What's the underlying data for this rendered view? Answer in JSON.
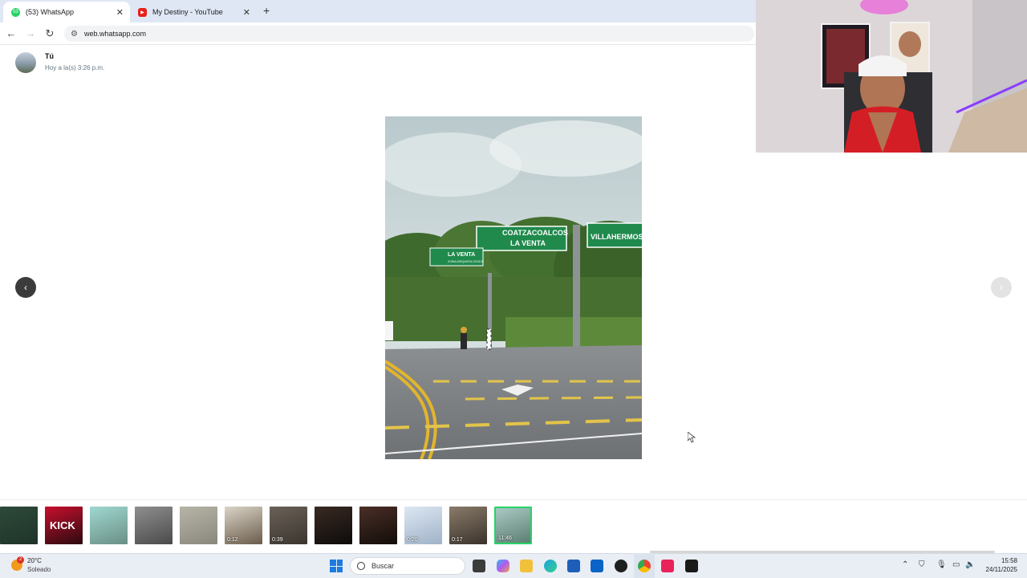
{
  "browser": {
    "tabs": [
      {
        "title": "(53) WhatsApp",
        "icon": "whatsapp-icon",
        "active": true
      },
      {
        "title": "My Destiny - YouTube",
        "icon": "youtube-icon",
        "active": false
      }
    ],
    "url": "web.whatsapp.com"
  },
  "viewer": {
    "sender": "Tú",
    "timestamp": "Hoy a la(s) 3:26 p.m.",
    "photo_signs": {
      "main_line1": "COATZACOALCOS",
      "main_line2": "LA VENTA",
      "right": "VILLAHERMOSA C",
      "left_line1": "LA VENTA",
      "left_line2": "ZONA ARQUEOLOGICA"
    }
  },
  "thumbnails": [
    {
      "kind": "image",
      "duration": "",
      "palette": [
        "#2d4a3a",
        "#1f3329"
      ]
    },
    {
      "kind": "image",
      "duration": "",
      "palette": [
        "#c8102e",
        "#2a0a0f"
      ],
      "text": "KICK"
    },
    {
      "kind": "image",
      "duration": "",
      "palette": [
        "#9fd8d0",
        "#6a8f86"
      ]
    },
    {
      "kind": "image",
      "duration": "",
      "palette": [
        "#8f8f8f",
        "#4a4a4a"
      ]
    },
    {
      "kind": "image",
      "duration": "",
      "palette": [
        "#b7b4a8",
        "#8a877c"
      ]
    },
    {
      "kind": "video",
      "duration": "0:12",
      "palette": [
        "#d9d4c7",
        "#6b5c4b"
      ]
    },
    {
      "kind": "video",
      "duration": "0:39",
      "palette": [
        "#6a6258",
        "#3c352f"
      ]
    },
    {
      "kind": "image",
      "duration": "",
      "palette": [
        "#3a2a24",
        "#0d0b0a"
      ]
    },
    {
      "kind": "image",
      "duration": "",
      "palette": [
        "#4a2f26",
        "#120c0a"
      ]
    },
    {
      "kind": "video",
      "duration": "0:20",
      "palette": [
        "#dde7f2",
        "#9fb2c8"
      ]
    },
    {
      "kind": "video",
      "duration": "0:17",
      "palette": [
        "#8a7b6a",
        "#3a332b"
      ]
    },
    {
      "kind": "video",
      "duration": "11:46",
      "palette": [
        "#a9c9c2",
        "#5c7f73"
      ],
      "selected": true
    }
  ],
  "taskbar": {
    "temperature": "20°C",
    "condition": "Soleado",
    "weather_badge": "2",
    "search_placeholder": "Buscar",
    "time": "15:58",
    "date": "24/11/2025"
  },
  "colors": {
    "whatsapp_green": "#25d366",
    "sign_green": "#1f8a4c",
    "youtube_red": "#e62117"
  }
}
